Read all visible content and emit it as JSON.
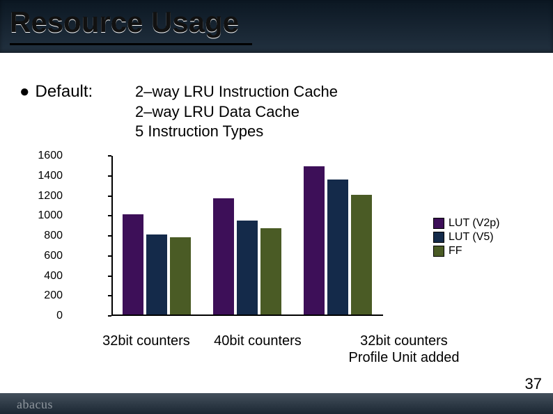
{
  "title": "Resource Usage",
  "bullet_label": "Default:",
  "desc_line1": "2–way LRU Instruction Cache",
  "desc_line2": "2–way LRU Data Cache",
  "desc_line3": "5 Instruction Types",
  "page_number": "37",
  "logo_text": "abacus",
  "legend": {
    "s0": "LUT (V2p)",
    "s1": "LUT (V5)",
    "s2": "FF"
  },
  "colors": {
    "s0": "#3d0f58",
    "s1": "#142a4a",
    "s2": "#4a5b25"
  },
  "chart_data": {
    "type": "bar",
    "title": "",
    "xlabel": "",
    "ylabel": "",
    "ylim": [
      0,
      1600
    ],
    "y_ticks": [
      0,
      200,
      400,
      600,
      800,
      1000,
      1200,
      1400,
      1600
    ],
    "categories": [
      "32bit counters",
      "40bit counters",
      "32bit counters\nProfile Unit added"
    ],
    "series": [
      {
        "name": "LUT (V2p)",
        "values": [
          1000,
          1160,
          1480
        ]
      },
      {
        "name": "LUT (V5)",
        "values": [
          800,
          940,
          1350
        ]
      },
      {
        "name": "FF",
        "values": [
          770,
          860,
          1200
        ]
      }
    ]
  }
}
